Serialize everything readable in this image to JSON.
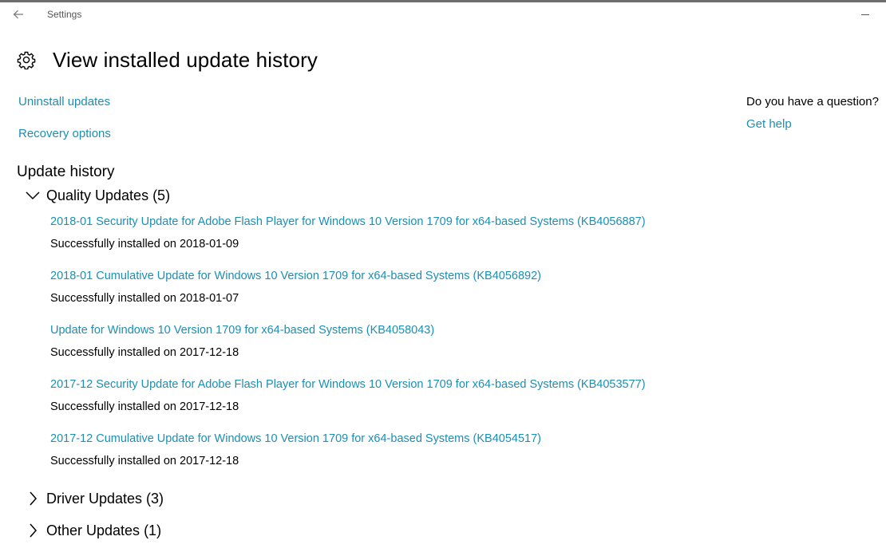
{
  "window": {
    "title": "Settings"
  },
  "page": {
    "title": "View installed update history"
  },
  "links": {
    "uninstall": "Uninstall updates",
    "recovery": "Recovery options"
  },
  "help": {
    "question": "Do you have a question?",
    "get_help": "Get help"
  },
  "history": {
    "title": "Update history",
    "quality": {
      "label": "Quality Updates (5)",
      "items": [
        {
          "title": "2018-01 Security Update for Adobe Flash Player for Windows 10 Version 1709 for x64-based Systems (KB4056887)",
          "status": "Successfully installed on 2018-01-09"
        },
        {
          "title": "2018-01 Cumulative Update for Windows 10 Version 1709 for x64-based Systems (KB4056892)",
          "status": "Successfully installed on 2018-01-07"
        },
        {
          "title": "Update for Windows 10 Version 1709 for x64-based Systems (KB4058043)",
          "status": "Successfully installed on 2017-12-18"
        },
        {
          "title": "2017-12 Security Update for Adobe Flash Player for Windows 10 Version 1709 for x64-based Systems (KB4053577)",
          "status": "Successfully installed on 2017-12-18"
        },
        {
          "title": "2017-12 Cumulative Update for Windows 10 Version 1709 for x64-based Systems (KB4054517)",
          "status": "Successfully installed on 2017-12-18"
        }
      ]
    },
    "driver": {
      "label": "Driver Updates (3)"
    },
    "other": {
      "label": "Other Updates (1)"
    }
  },
  "colors": {
    "link": "#1b8fb4",
    "text": "#000000",
    "background": "#ffffff"
  },
  "icons": {
    "back": "back-arrow-icon",
    "minimize": "minimize-icon",
    "page": "gear-icon",
    "expanded": "chevron-down-icon",
    "collapsed": "chevron-right-icon"
  }
}
